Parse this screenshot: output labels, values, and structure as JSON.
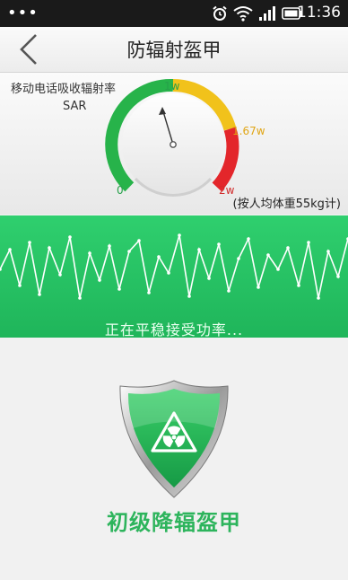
{
  "status_bar": {
    "time": "11:36",
    "icons": [
      "overflow-dots-icon",
      "alarm-icon",
      "wifi-icon",
      "signal-icon",
      "battery-icon"
    ]
  },
  "header": {
    "title": "防辐射盔甲",
    "back_icon": "chevron-left-icon"
  },
  "gauge": {
    "label": "移动电话吸收辐射率",
    "sub_label": "SAR",
    "scale_labels": {
      "min": "0",
      "mid": "1w",
      "high": "1.67w",
      "max": "2w"
    },
    "note": "(按人均体重55kg计)",
    "colors": {
      "green": "#27b34a",
      "yellow": "#f1c21b",
      "red": "#e3262b"
    }
  },
  "wave": {
    "status": "正在平稳接受功率...",
    "color": "#22c061"
  },
  "shield": {
    "icon": "radiation-shield-icon",
    "level_label": "初级降辐盔甲",
    "color": "#28b457"
  }
}
